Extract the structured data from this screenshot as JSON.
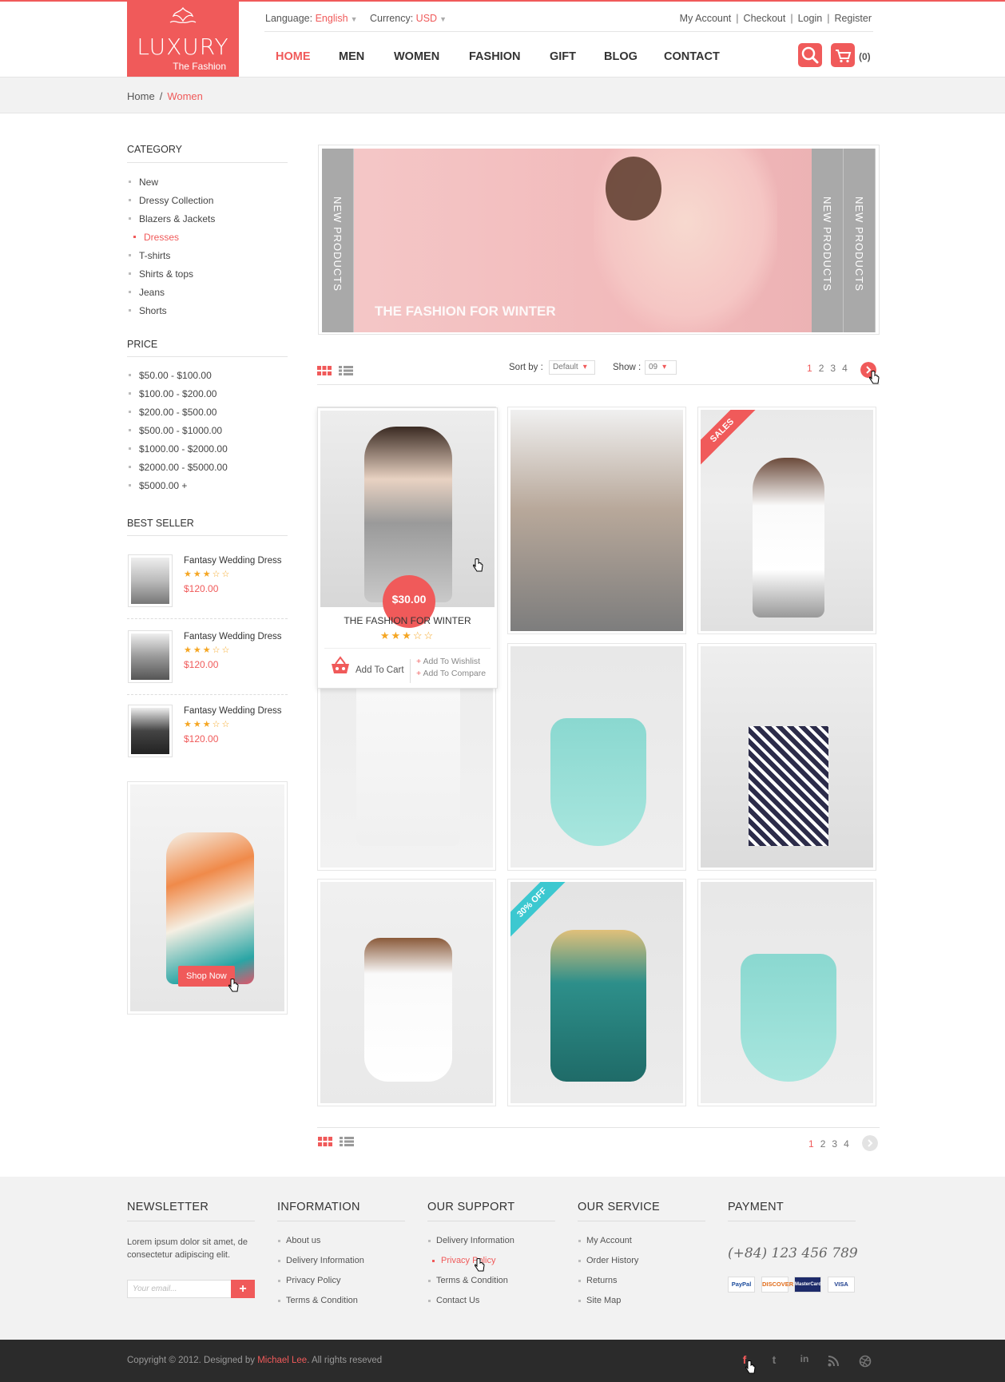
{
  "header": {
    "logo": {
      "brand": "LUXURY",
      "tagline": "The Fashion"
    },
    "language_label": "Language:",
    "language_value": "English",
    "currency_label": "Currency:",
    "currency_value": "USD",
    "account_links": [
      "My Account",
      "Checkout",
      "Login",
      "Register"
    ],
    "nav": [
      "HOME",
      "MEN",
      "WOMEN",
      "FASHION",
      "GIFT",
      "BLOG",
      "CONTACT"
    ],
    "cart_count": "(0)"
  },
  "breadcrumb": {
    "home": "Home",
    "current": "Women"
  },
  "sidebar": {
    "category_title": "CATEGORY",
    "categories": [
      "New",
      "Dressy Collection",
      "Blazers & Jackets",
      "Dresses",
      "T-shirts",
      "Shirts & tops",
      "Jeans",
      "Shorts"
    ],
    "active_category": "Dresses",
    "price_title": "PRICE",
    "prices": [
      "$50.00 - $100.00",
      "$100.00 - $200.00",
      "$200.00 - $500.00",
      "$500.00 - $1000.00",
      "$1000.00 - $2000.00",
      "$2000.00 - $5000.00",
      "$5000.00 +"
    ],
    "bestseller_title": "BEST SELLER",
    "bestsellers": [
      {
        "name": "Fantasy Wedding Dress",
        "stars": "★★★☆☆",
        "price": "$120.00"
      },
      {
        "name": "Fantasy Wedding Dress",
        "stars": "★★★☆☆",
        "price": "$120.00"
      },
      {
        "name": "Fantasy Wedding Dress",
        "stars": "★★★☆☆",
        "price": "$120.00"
      }
    ],
    "promo_button": "Shop Now"
  },
  "banner": {
    "tab_label": "NEW PRODUCTS",
    "title": "THE FASHION FOR WINTER"
  },
  "toolbar": {
    "sort_label": "Sort by :",
    "sort_value": "Default",
    "show_label": "Show :",
    "show_value": "09",
    "pages": [
      "1",
      "2",
      "3",
      "4"
    ],
    "current_page": "1"
  },
  "products": {
    "quickview": {
      "price": "$30.00",
      "name": "THE FASHION FOR WINTER",
      "stars": "★★★☆☆",
      "add_to_cart": "Add To Cart",
      "add_to_wishlist": "Add To Wishlist",
      "add_to_compare": "Add To Compare"
    },
    "sales_ribbon": "SALES",
    "off_ribbon": "30% OFF"
  },
  "footer": {
    "newsletter_title": "NEWSLETTER",
    "newsletter_text": "Lorem ipsum dolor sit amet, de consectetur adipiscing elit.",
    "email_placeholder": "Your email...",
    "information_title": "INFORMATION",
    "information": [
      "About us",
      "Delivery Information",
      "Privacy Policy",
      "Terms & Condition"
    ],
    "support_title": "OUR SUPPORT",
    "support": [
      "Delivery Information",
      "Privacy Policy",
      "Terms & Condition",
      "Contact Us"
    ],
    "service_title": "OUR SERVICE",
    "service": [
      "My Account",
      "Order History",
      "Returns",
      "Site Map"
    ],
    "payment_title": "PAYMENT",
    "phone": "(+84) 123 456 789",
    "payment_cards": [
      "PayPal",
      "DISCOVER",
      "MasterCard",
      "VISA"
    ],
    "copyright_prefix": "Copyright © 2012. Designed by ",
    "designer": "Michael Lee",
    "copyright_suffix": ". All rights reseved",
    "social": [
      "facebook-icon",
      "twitter-icon",
      "linkedin-icon",
      "rss-icon",
      "dribbble-icon"
    ]
  },
  "colors": {
    "accent": "#f05a5a",
    "teal": "#3cc8d0",
    "dark": "#2b2b2b"
  }
}
